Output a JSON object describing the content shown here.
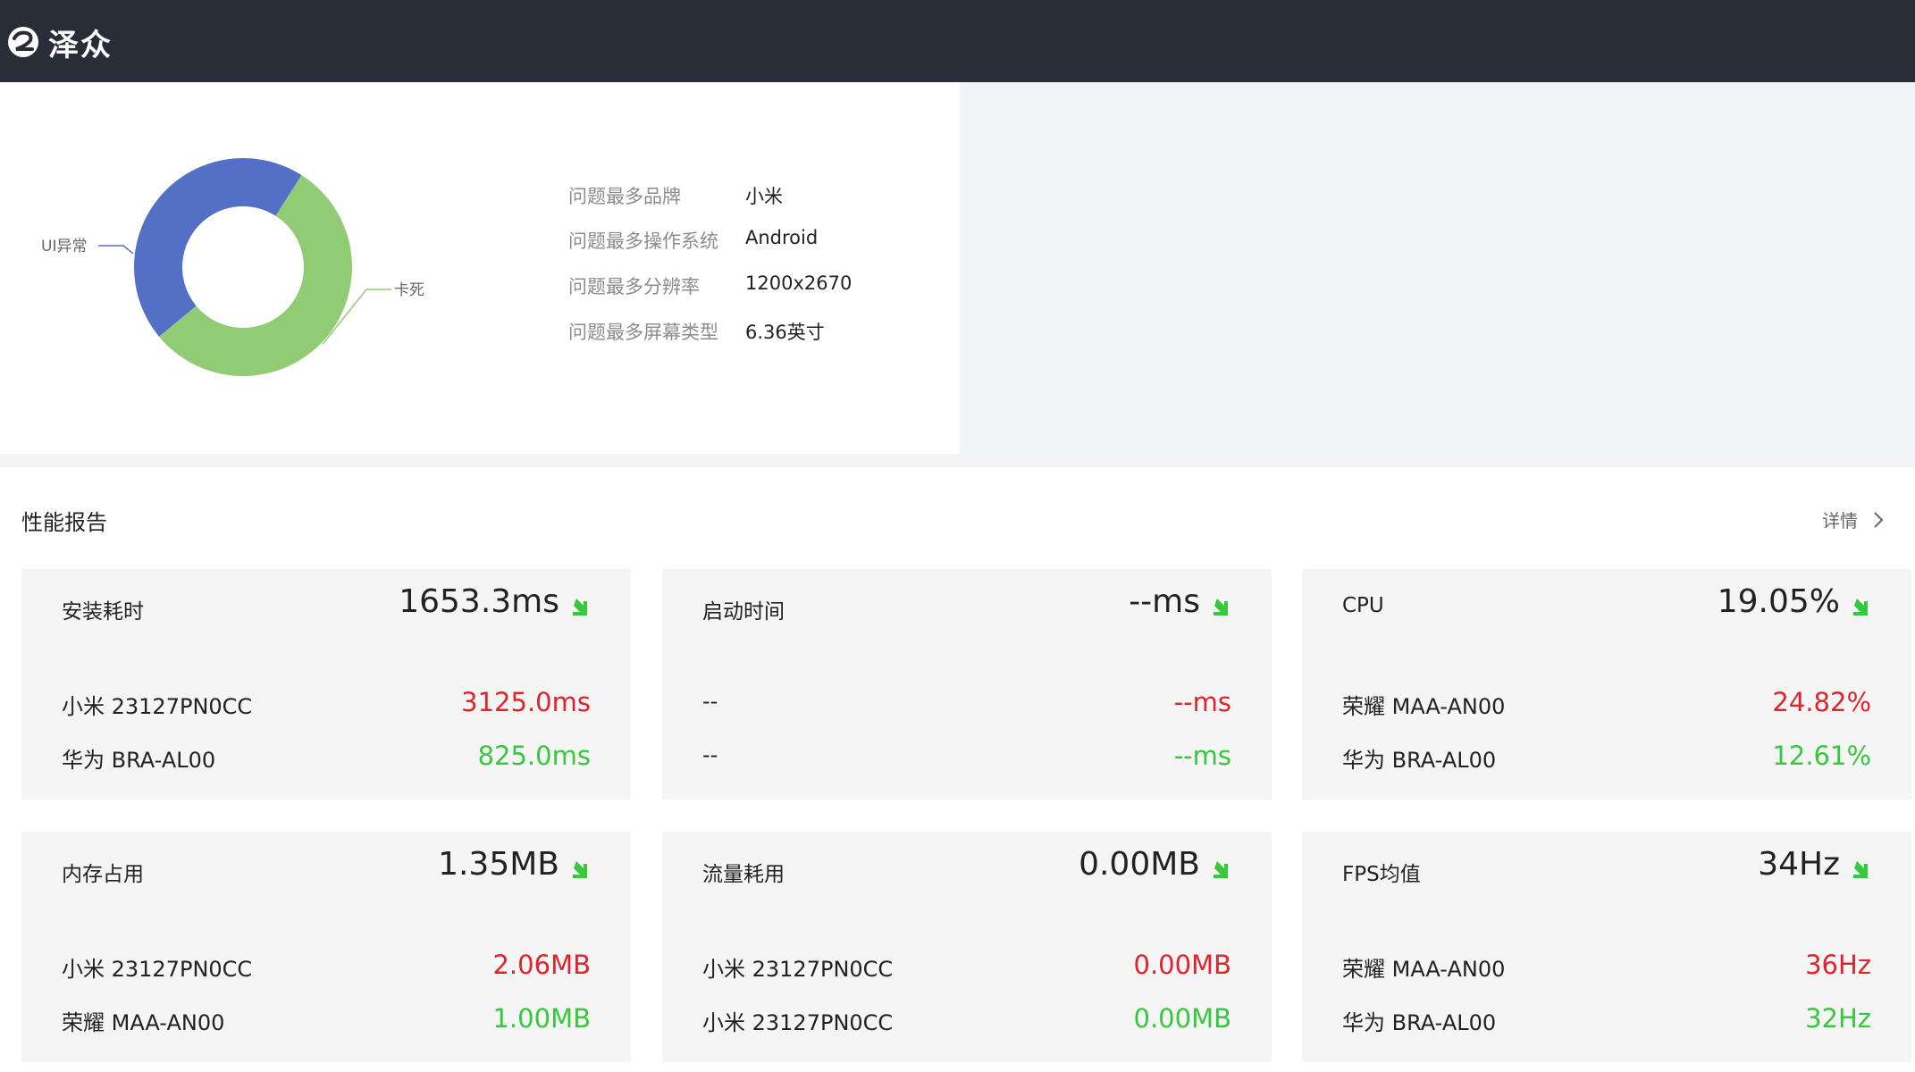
{
  "header": {
    "logo_text": "泽众",
    "logo_icon": "zezhong-logo-icon"
  },
  "overview": {
    "chart_data": {
      "type": "pie",
      "categories": [
        "卡死",
        "UI异常"
      ],
      "values": [
        55,
        45
      ],
      "colors": [
        "#91cc75",
        "#5470c6"
      ],
      "legend": "none"
    },
    "stats": [
      {
        "label": "问题最多品牌",
        "value": "小米"
      },
      {
        "label": "问题最多操作系统",
        "value": "Android"
      },
      {
        "label": "问题最多分辨率",
        "value": "1200x2670"
      },
      {
        "label": "问题最多屏幕类型",
        "value": "6.36英寸"
      }
    ]
  },
  "performance": {
    "title": "性能报告",
    "detail_label": "详情",
    "cards": [
      {
        "title": "安装耗时",
        "main_value": "1653.3ms",
        "rows": [
          {
            "label": "小米 23127PN0CC",
            "value": "3125.0ms"
          },
          {
            "label": "华为 BRA-AL00",
            "value": "825.0ms"
          }
        ]
      },
      {
        "title": "启动时间",
        "main_value": "--ms",
        "rows": [
          {
            "label": "--",
            "value": "--ms"
          },
          {
            "label": "--",
            "value": "--ms"
          }
        ]
      },
      {
        "title": "CPU",
        "main_value": "19.05%",
        "rows": [
          {
            "label": "荣耀 MAA-AN00",
            "value": "24.82%"
          },
          {
            "label": "华为 BRA-AL00",
            "value": "12.61%"
          }
        ]
      },
      {
        "title": "内存占用",
        "main_value": "1.35MB",
        "rows": [
          {
            "label": "小米 23127PN0CC",
            "value": "2.06MB"
          },
          {
            "label": "荣耀 MAA-AN00",
            "value": "1.00MB"
          }
        ]
      },
      {
        "title": "流量耗用",
        "main_value": "0.00MB",
        "rows": [
          {
            "label": "小米 23127PN0CC",
            "value": "0.00MB"
          },
          {
            "label": "小米 23127PN0CC",
            "value": "0.00MB"
          }
        ]
      },
      {
        "title": "FPS均值",
        "main_value": "34Hz",
        "rows": [
          {
            "label": "荣耀 MAA-AN00",
            "value": "36Hz"
          },
          {
            "label": "华为 BRA-AL00",
            "value": "32Hz"
          }
        ]
      }
    ],
    "colors": {
      "max": "#e0242b",
      "min": "#35c93b",
      "arrow": "#35c93b"
    }
  }
}
